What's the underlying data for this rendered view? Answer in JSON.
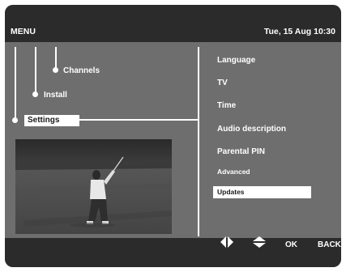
{
  "header": {
    "title": "MENU",
    "datetime": "Tue, 15 Aug 10:30"
  },
  "tree": {
    "items": [
      {
        "label": "Channels"
      },
      {
        "label": "Install"
      },
      {
        "label": "Settings",
        "selected": true
      }
    ]
  },
  "preview": {
    "image": "golfer-swing-photo"
  },
  "settings_menu": {
    "items": [
      {
        "label": "Language",
        "size": "normal"
      },
      {
        "label": "TV",
        "size": "normal"
      },
      {
        "label": "Time",
        "size": "normal"
      },
      {
        "label": "Audio description",
        "size": "normal"
      },
      {
        "label": "Parental PIN",
        "size": "normal"
      },
      {
        "label": "Advanced",
        "size": "small"
      },
      {
        "label": "Updates",
        "size": "small",
        "selected": true
      }
    ]
  },
  "footer": {
    "nav_left_right_icon": "left-right-arrows-icon",
    "nav_up_down_icon": "up-down-arrows-icon",
    "ok_label": "OK",
    "back_label": "BACK"
  },
  "colors": {
    "panel_bg": "#6e6e6e",
    "bar_bg": "#2b2b2b",
    "highlight": "#ffffff"
  }
}
